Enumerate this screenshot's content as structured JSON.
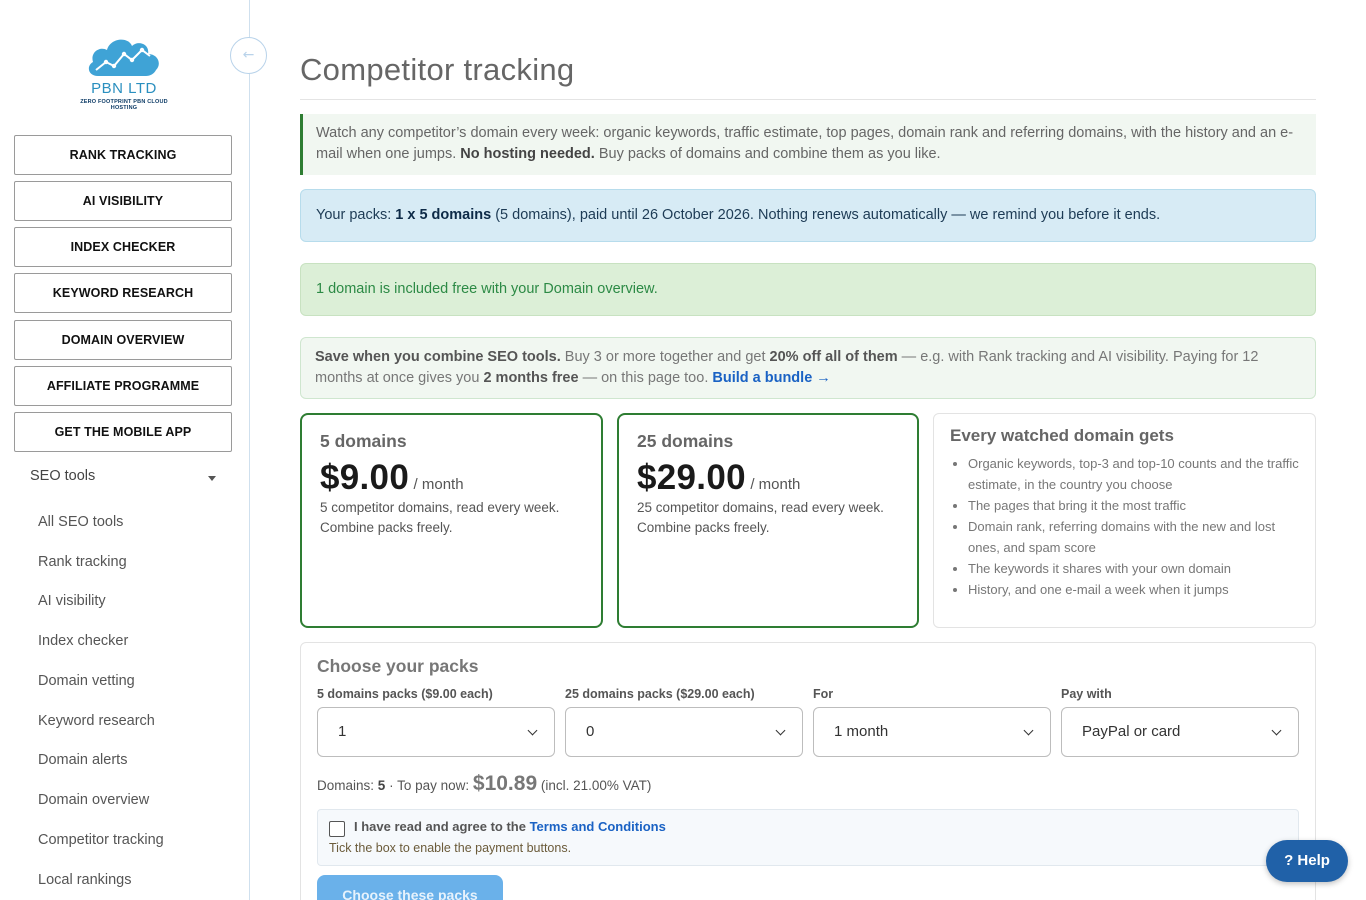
{
  "brand": {
    "name": "PBN LTD",
    "tagline": "ZERO FOOTPRINT PBN CLOUD HOSTING"
  },
  "sidebar": {
    "collapse_icon": "←",
    "buttons": [
      "RANK TRACKING",
      "AI VISIBILITY",
      "INDEX CHECKER",
      "KEYWORD RESEARCH",
      "DOMAIN OVERVIEW",
      "AFFILIATE PROGRAMME",
      "GET THE MOBILE APP"
    ],
    "section_label": "SEO tools",
    "items": [
      "All SEO tools",
      "Rank tracking",
      "AI visibility",
      "Index checker",
      "Domain vetting",
      "Keyword research",
      "Domain alerts",
      "Domain overview",
      "Competitor tracking",
      "Local rankings"
    ]
  },
  "page": {
    "title": "Competitor tracking"
  },
  "intro": {
    "text": "Watch any competitor’s domain every week: organic keywords, traffic estimate, top pages, domain rank and referring domains, with the history and an e-mail when one jumps.",
    "bold": "No hosting needed.",
    "tail": "Buy packs of domains and combine them as you like."
  },
  "packs_notice": {
    "prefix": "Your packs:",
    "bold": "1 x 5 domains",
    "rest": "(5 domains), paid until 26 October 2026. Nothing renews automatically — we remind you before it ends."
  },
  "free_notice": "1 domain is included free with your Domain overview.",
  "save_notice": {
    "bold1": "Save when you combine SEO tools.",
    "t1": "Buy 3 or more together and get",
    "bold2": "20% off all of them",
    "t2": "— e.g. with Rank tracking and AI visibility. Paying for 12 months at once gives you",
    "bold3": "2 months free",
    "t3": "— on this page too.",
    "link": "Build a bundle →"
  },
  "plans": [
    {
      "name": "5 domains",
      "price": "$9.00",
      "period": "/ month",
      "desc": "5 competitor domains, read every week. Combine packs freely."
    },
    {
      "name": "25 domains",
      "price": "$29.00",
      "period": "/ month",
      "desc": "25 competitor domains, read every week. Combine packs freely."
    }
  ],
  "benefits": {
    "title": "Every watched domain gets",
    "items": [
      "Organic keywords, top-3 and top-10 counts and the traffic estimate, in the country you choose",
      "The pages that bring it the most traffic",
      "Domain rank, referring domains with the new and lost ones, and spam score",
      "The keywords it shares with your own domain",
      "History, and one e-mail a week when it jumps"
    ]
  },
  "choose": {
    "title": "Choose your packs",
    "fields": [
      {
        "label": "5 domains packs ($9.00 each)",
        "value": "1"
      },
      {
        "label": "25 domains packs ($29.00 each)",
        "value": "0"
      },
      {
        "label": "For",
        "value": "1 month"
      },
      {
        "label": "Pay with",
        "value": "PayPal or card"
      }
    ],
    "domains_label": "Domains:",
    "domains_value": "5",
    "pay_label": "· To pay now:",
    "pay_amount": "$10.89",
    "vat_note": "(incl. 21.00% VAT)",
    "terms_prefix": "I have read and agree to the",
    "terms_link": "Terms and Conditions",
    "terms_hint": "Tick the box to enable the payment buttons.",
    "submit": "Choose these packs"
  },
  "help": "? Help",
  "colors": {
    "accent_green": "#2e7d32",
    "link_blue": "#1a62c4",
    "help_blue": "#2061a8"
  }
}
